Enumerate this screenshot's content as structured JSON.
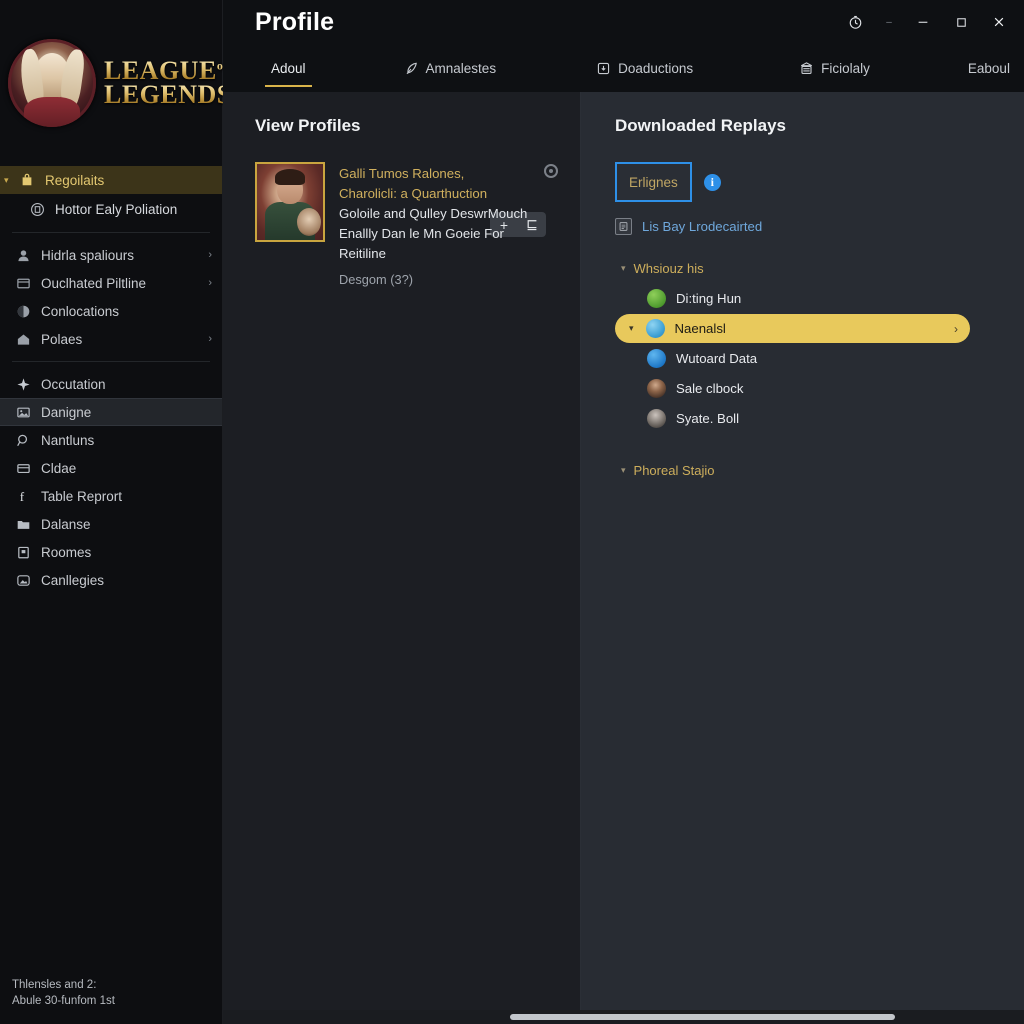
{
  "window": {
    "title": "Profile",
    "controls": [
      {
        "name": "history-icon",
        "glyph": "⏱"
      },
      {
        "name": "more-dash",
        "glyph": "–"
      },
      {
        "name": "minimize",
        "glyph": "—"
      },
      {
        "name": "maximize",
        "glyph": "☐"
      },
      {
        "name": "close",
        "glyph": "✕"
      }
    ]
  },
  "brand": {
    "line1": "LEAGUE",
    "of": "of",
    "line2": "LEGENDS"
  },
  "sidebar": {
    "items": [
      {
        "label": "Regoilaits",
        "icon": "bag-icon",
        "caret": "▾",
        "state": "active-gold",
        "chevron": ""
      },
      {
        "label": "Hottor Ealy Poliation",
        "icon": "badge-icon",
        "state": "sub",
        "chevron": ""
      },
      {
        "label": "Hidrla spaliours",
        "icon": "person-icon",
        "state": "",
        "chevron": "›"
      },
      {
        "label": "Ouclhated Piltline",
        "icon": "window-icon",
        "state": "",
        "chevron": "›"
      },
      {
        "label": "Conlocations",
        "icon": "contrast-icon",
        "state": "",
        "chevron": ""
      },
      {
        "label": "Polaes",
        "icon": "home-icon",
        "state": "",
        "chevron": "›"
      },
      {
        "label": "Occutation",
        "icon": "sparkle-icon",
        "state": "",
        "chevron": ""
      },
      {
        "label": "Danigne",
        "icon": "image-icon",
        "state": "selected",
        "chevron": ""
      },
      {
        "label": "Nantluns",
        "icon": "search-icon",
        "state": "",
        "chevron": ""
      },
      {
        "label": "Cldae",
        "icon": "inbox-icon",
        "state": "",
        "chevron": ""
      },
      {
        "label": "Table Reprort",
        "icon": "f-icon",
        "state": "",
        "chevron": ""
      },
      {
        "label": "Dalanse",
        "icon": "folder-icon",
        "state": "",
        "chevron": ""
      },
      {
        "label": "Roomes",
        "icon": "building-icon",
        "state": "",
        "chevron": ""
      },
      {
        "label": "Canllegies",
        "icon": "cloud-icon",
        "state": "",
        "chevron": ""
      }
    ],
    "footer_line1": "Thlensles and 2:",
    "footer_line2": "Abule 30-funfom 1st"
  },
  "tabs": [
    {
      "label": "Adoul",
      "icon": "",
      "active": true
    },
    {
      "label": "Amnalestes",
      "icon": "feather-icon",
      "active": false
    },
    {
      "label": "Doaductions",
      "icon": "download-box-icon",
      "active": false
    },
    {
      "label": "Ficiolaly",
      "icon": "archive-icon",
      "active": false
    },
    {
      "label": "Eaboul",
      "icon": "",
      "active": false
    }
  ],
  "left_panel": {
    "title": "View Profiles",
    "buttons": [
      {
        "name": "add-profile-button",
        "glyph": "+"
      },
      {
        "name": "compare-profile-button",
        "glyph": "⊑"
      }
    ],
    "profile": {
      "title_line1": "Galli Tumos  Ralones,",
      "title_line2": "Charolicli: a Quarthuction",
      "body_line1": "Goloile and Qulley DeswrMouch",
      "body_line2": "Enallly Dan le Mn Goeie For",
      "body_line3": "Reitiline",
      "meta": "Desgom (3?)",
      "badge": "status-dot"
    }
  },
  "right_panel": {
    "title": "Downloaded Replays",
    "action_button": "Erlignes",
    "info_badge": "i",
    "link_text": "Lis Bay Lrodecairted",
    "groups": [
      {
        "label": "Whsiouz his",
        "caret": "▾",
        "items": [
          {
            "label": "Di:ting Hun",
            "avatar": "av-green",
            "highlight": false,
            "chevron": ""
          },
          {
            "label": "Naenalsl",
            "avatar": "av-cyan",
            "highlight": true,
            "chevron": "›",
            "caret": "▾"
          },
          {
            "label": "Wutoard Data",
            "avatar": "av-blue",
            "highlight": false,
            "chevron": ""
          },
          {
            "label": "Sale clbock",
            "avatar": "av-photo1",
            "highlight": false,
            "chevron": ""
          },
          {
            "label": "Syate. Boll",
            "avatar": "av-photo2",
            "highlight": false,
            "chevron": ""
          }
        ]
      },
      {
        "label": "Phoreal Stajio",
        "caret": "▾",
        "items": []
      }
    ]
  },
  "colors": {
    "accent_gold": "#e8c95c",
    "accent_blue": "#2e90e8",
    "link_blue": "#6fa8dc",
    "sidebar_bg": "#0d0e11",
    "panel_left_bg": "#1c1e23",
    "panel_right_bg": "#282c33"
  }
}
